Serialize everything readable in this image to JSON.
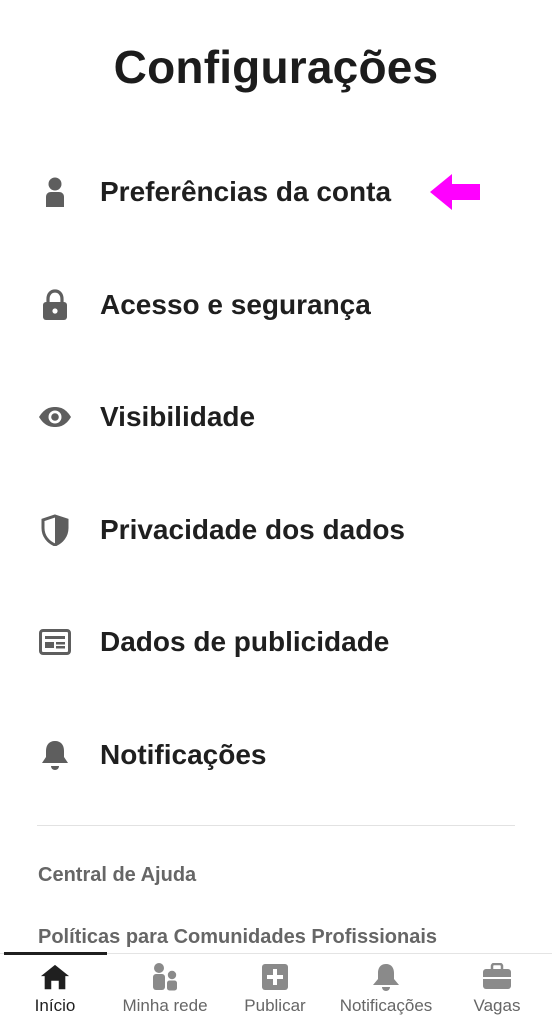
{
  "page_title": "Configurações",
  "menu": {
    "items": [
      {
        "label": "Preferências da conta",
        "icon": "person-icon"
      },
      {
        "label": "Acesso e segurança",
        "icon": "lock-icon"
      },
      {
        "label": "Visibilidade",
        "icon": "eye-icon"
      },
      {
        "label": "Privacidade dos dados",
        "icon": "shield-icon"
      },
      {
        "label": "Dados de publicidade",
        "icon": "ad-card-icon"
      },
      {
        "label": "Notificações",
        "icon": "bell-icon"
      }
    ]
  },
  "annotation": {
    "icon": "magenta-arrow-icon",
    "color": "#ff00ff"
  },
  "links": {
    "help": "Central de Ajuda",
    "policies": "Políticas para Comunidades Profissionais"
  },
  "bottom_nav": {
    "items": [
      {
        "label": "Início",
        "icon": "home-icon",
        "active": true
      },
      {
        "label": "Minha rede",
        "icon": "network-icon",
        "active": false
      },
      {
        "label": "Publicar",
        "icon": "plus-square-icon",
        "active": false
      },
      {
        "label": "Notificações",
        "icon": "bell-icon",
        "active": false
      },
      {
        "label": "Vagas",
        "icon": "briefcase-icon",
        "active": false
      }
    ]
  },
  "colors": {
    "icon": "#5e5e5e",
    "text": "#1f1f1f",
    "muted": "#666666",
    "active_icon": "#1f1f1f"
  }
}
